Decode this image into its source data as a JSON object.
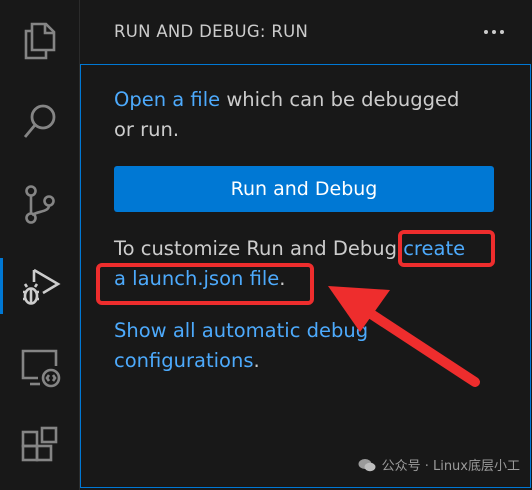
{
  "activity_bar": {
    "items": [
      {
        "name": "explorer",
        "icon": "files-icon",
        "active": false
      },
      {
        "name": "search",
        "icon": "search-icon",
        "active": false
      },
      {
        "name": "source-control",
        "icon": "source-control-icon",
        "active": false
      },
      {
        "name": "run-and-debug",
        "icon": "run-debug-icon",
        "active": true
      },
      {
        "name": "remote-explorer",
        "icon": "remote-explorer-icon",
        "active": false
      },
      {
        "name": "extensions",
        "icon": "extensions-icon",
        "active": false
      }
    ]
  },
  "sidebar": {
    "title": "RUN AND DEBUG: RUN",
    "more_actions_icon": "ellipsis-icon"
  },
  "panel": {
    "intro_link": "Open a file",
    "intro_text_1": " which can be debugged",
    "intro_text_2": "or run.",
    "run_button_label": "Run and Debug",
    "customize_text": "To customize Run and Debug ",
    "create_link_1": "create",
    "create_link_2": "a launch.json file",
    "period": ".",
    "show_all_link_1": "Show all automatic debug",
    "show_all_link_2": "configurations",
    "period_2": "."
  },
  "watermark": {
    "text": "公众号 · Linux底层小工",
    "icon": "wechat-icon"
  },
  "colors": {
    "background": "#181818",
    "text": "#cccccc",
    "link": "#4daafc",
    "accent": "#0078d4",
    "annotation": "#ee2d2d"
  }
}
